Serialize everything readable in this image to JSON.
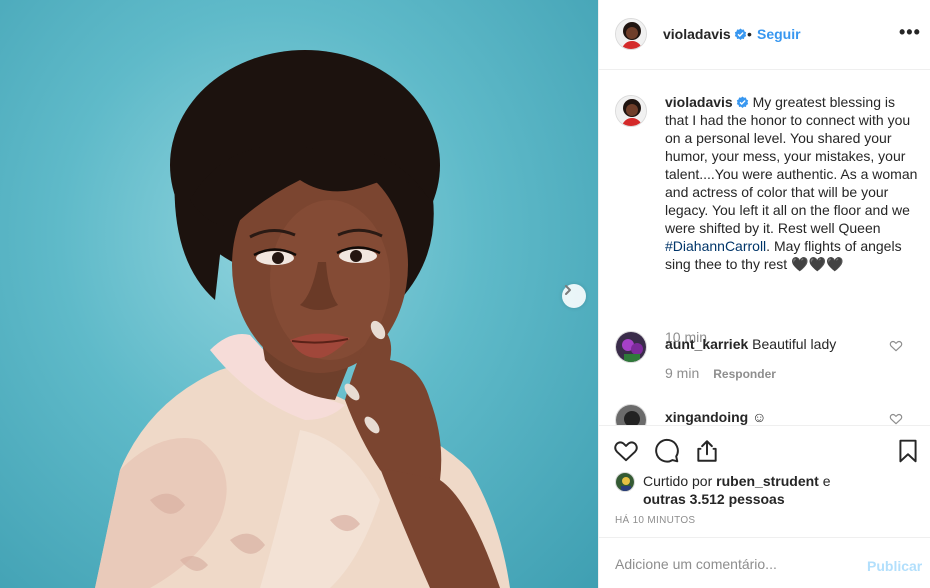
{
  "post": {
    "username": "violadavis",
    "follow_label": "Seguir",
    "separator": "•",
    "more_label": "•••"
  },
  "caption": {
    "username": "violadavis",
    "text_part1": "My greatest blessing is that I had the honor to connect with you on a personal level. You shared your humor, your mess, your mistakes, your talent....You were authentic. As a woman and actress of color that will be your legacy. You left it all on the floor and we were shifted by it. Rest well Queen ",
    "hashtag": "#DiahannCarroll",
    "text_part2": ". May flights of angels sing thee to thy rest ",
    "emoji": "🖤🖤🖤",
    "time": "10 min"
  },
  "comments": [
    {
      "username": "aunt_karriek",
      "text": "Beautiful lady",
      "time": "9 min",
      "reply_label": "Responder"
    },
    {
      "username": "xingandoing",
      "text": "☺"
    }
  ],
  "likes": {
    "prefix": "Curtido por ",
    "username": "ruben_strudent",
    "connector": " e",
    "others": "outras 3.512 pessoas"
  },
  "post_time": "HÁ 10 MINUTOS",
  "add_comment": {
    "placeholder": "Adicione um comentário...",
    "publish_label": "Publicar"
  },
  "colors": {
    "accent": "#3897f0",
    "verified": "#3897f0",
    "muted": "#8e8e8e",
    "publish_disabled": "#b2dffc",
    "background_photo": "#5fbac9"
  },
  "icons": {
    "next": "chevron-right-icon",
    "like": "heart-icon",
    "comment": "comment-bubble-icon",
    "share": "share-icon",
    "save": "bookmark-icon",
    "more": "more-dots-icon",
    "verified": "verified-badge-icon"
  }
}
